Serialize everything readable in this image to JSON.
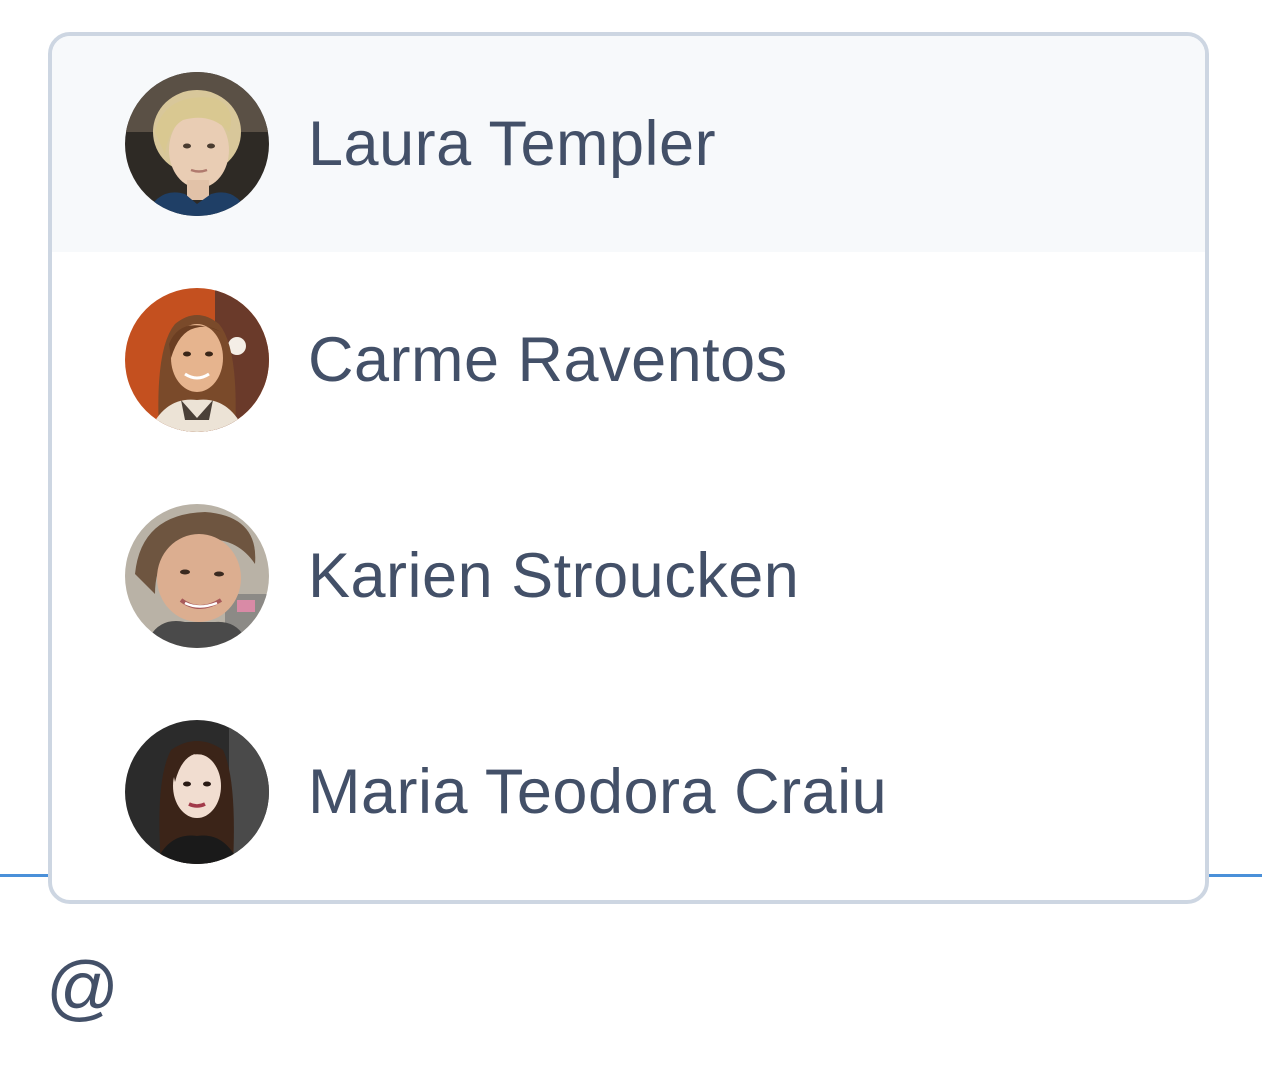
{
  "mention_popup": {
    "items": [
      {
        "name": "Laura Templer",
        "highlighted": true,
        "avatar": "laura-templer-avatar"
      },
      {
        "name": "Carme Raventos",
        "highlighted": false,
        "avatar": "carme-raventos-avatar"
      },
      {
        "name": "Karien Stroucken",
        "highlighted": false,
        "avatar": "karien-stroucken-avatar"
      },
      {
        "name": "Maria Teodora Craiu",
        "highlighted": false,
        "avatar": "maria-teodora-craiu-avatar"
      }
    ]
  },
  "editor": {
    "value": "@"
  },
  "colors": {
    "text": "#435068",
    "popup_border": "#cdd6e2",
    "highlight_bg": "#f7f9fb",
    "focus_line": "#4a90d9"
  }
}
